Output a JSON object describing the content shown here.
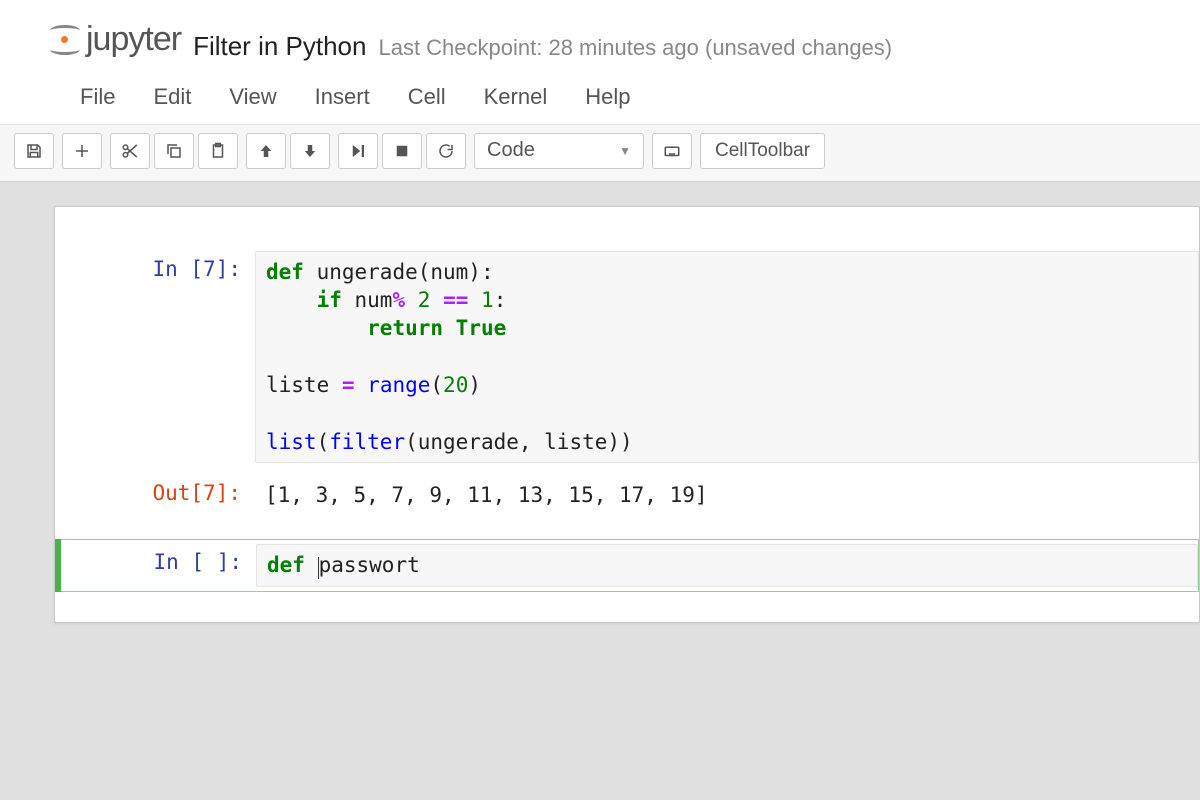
{
  "header": {
    "logo_text": "jupyter",
    "notebook_title": "Filter in Python",
    "checkpoint_text": "Last Checkpoint: 28 minutes ago (unsaved changes)"
  },
  "menubar": {
    "items": [
      "File",
      "Edit",
      "View",
      "Insert",
      "Cell",
      "Kernel",
      "Help"
    ]
  },
  "toolbar": {
    "cell_type_selected": "Code",
    "cell_toolbar_label": "CellToolbar"
  },
  "cells": [
    {
      "type": "code",
      "exec_count": 7,
      "in_prompt": "In [7]:",
      "source_tokens": [
        [
          [
            "kw",
            "def"
          ],
          [
            "nm",
            " ungerade(num):"
          ]
        ],
        [
          [
            "nm",
            "    "
          ],
          [
            "kw",
            "if"
          ],
          [
            "nm",
            " num"
          ],
          [
            "op",
            "%"
          ],
          [
            "nm",
            " "
          ],
          [
            "num",
            "2"
          ],
          [
            "nm",
            " "
          ],
          [
            "op",
            "=="
          ],
          [
            "nm",
            " "
          ],
          [
            "num",
            "1"
          ],
          [
            "nm",
            ":"
          ]
        ],
        [
          [
            "nm",
            "        "
          ],
          [
            "kw",
            "return"
          ],
          [
            "nm",
            " "
          ],
          [
            "bool",
            "True"
          ]
        ],
        [
          [
            "nm",
            ""
          ]
        ],
        [
          [
            "nm",
            "liste "
          ],
          [
            "op",
            "="
          ],
          [
            "nm",
            " "
          ],
          [
            "bn",
            "range"
          ],
          [
            "nm",
            "("
          ],
          [
            "num",
            "20"
          ],
          [
            "nm",
            ")"
          ]
        ],
        [
          [
            "nm",
            ""
          ]
        ],
        [
          [
            "bn",
            "list"
          ],
          [
            "nm",
            "("
          ],
          [
            "bn",
            "filter"
          ],
          [
            "nm",
            "(ungerade, liste))"
          ]
        ]
      ],
      "out_prompt": "Out[7]:",
      "output_text": "[1, 3, 5, 7, 9, 11, 13, 15, 17, 19]"
    },
    {
      "type": "code",
      "exec_count": null,
      "in_prompt": "In [ ]:",
      "active": true,
      "source_tokens": [
        [
          [
            "kw",
            "def"
          ],
          [
            "nm",
            " "
          ],
          [
            "cursor",
            ""
          ],
          [
            "nm",
            "passwort"
          ]
        ]
      ]
    }
  ]
}
